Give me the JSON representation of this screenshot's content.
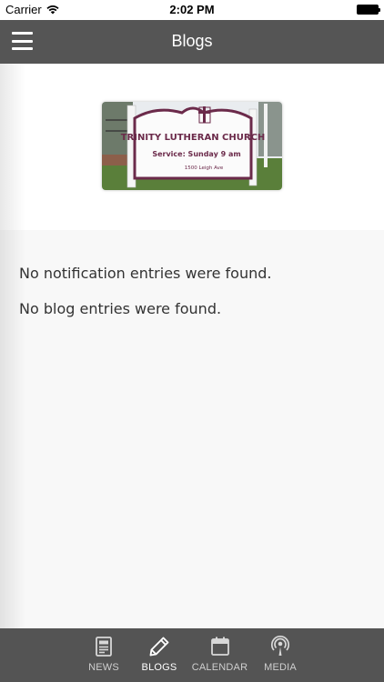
{
  "status_bar": {
    "carrier": "Carrier",
    "time": "2:02 PM"
  },
  "header": {
    "title": "Blogs"
  },
  "banner": {
    "sign_line1": "TRINITY LUTHERAN CHURCH",
    "sign_line2": "Service: Sunday 9 am",
    "sign_line3": "1500 Leigh Ave"
  },
  "content": {
    "notifications_empty": "No notification entries were found.",
    "blogs_empty": "No blog entries were found."
  },
  "tabs": [
    {
      "label": "NEWS",
      "icon": "news-icon",
      "active": false
    },
    {
      "label": "BLOGS",
      "icon": "pencil-icon",
      "active": true
    },
    {
      "label": "CALENDAR",
      "icon": "calendar-icon",
      "active": false
    },
    {
      "label": "MEDIA",
      "icon": "podcast-icon",
      "active": false
    }
  ],
  "colors": {
    "header_bg": "#555555",
    "tab_bar_bg": "#545454",
    "sign_accent": "#6b2a4a"
  }
}
